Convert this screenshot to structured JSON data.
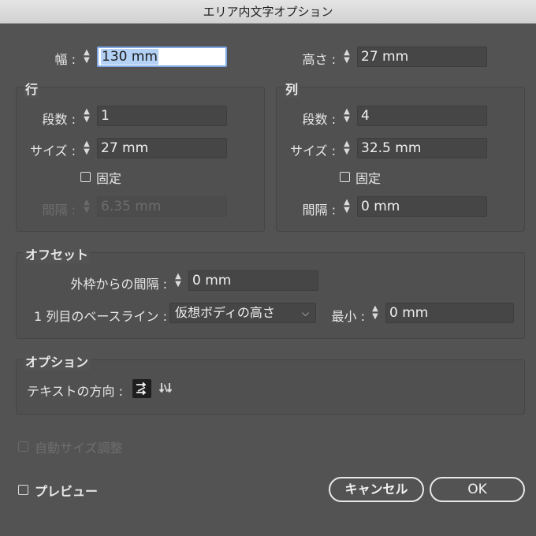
{
  "window": {
    "title": "エリア内文字オプション"
  },
  "top": {
    "width": {
      "label": "幅 :",
      "value": "130 mm"
    },
    "height": {
      "label": "高さ :",
      "value": "27 mm"
    }
  },
  "rows": {
    "title": "行",
    "count": {
      "label": "段数 :",
      "value": "1"
    },
    "size": {
      "label": "サイズ :",
      "value": "27 mm"
    },
    "fixed_label": "固定",
    "gutter": {
      "label": "間隔 :",
      "value": "6.35 mm"
    }
  },
  "columns": {
    "title": "列",
    "count": {
      "label": "段数 :",
      "value": "4"
    },
    "size": {
      "label": "サイズ :",
      "value": "32.5 mm"
    },
    "fixed_label": "固定",
    "gutter": {
      "label": "間隔 :",
      "value": "0 mm"
    }
  },
  "offset": {
    "title": "オフセット",
    "inset": {
      "label": "外枠からの間隔 :",
      "value": "0 mm"
    },
    "first_baseline": {
      "label": "1 列目のベースライン :",
      "selected": "仮想ボディの高さ"
    },
    "min": {
      "label": "最小 :",
      "value": "0 mm"
    }
  },
  "options": {
    "title": "オプション",
    "text_flow_label": "テキストの方向 :"
  },
  "auto_size_label": "自動サイズ調整",
  "preview_label": "プレビュー",
  "buttons": {
    "cancel": "キャンセル",
    "ok": "OK"
  },
  "colors": {
    "background": "#535353",
    "field": "#464646",
    "focus": "#7fa8e6"
  }
}
